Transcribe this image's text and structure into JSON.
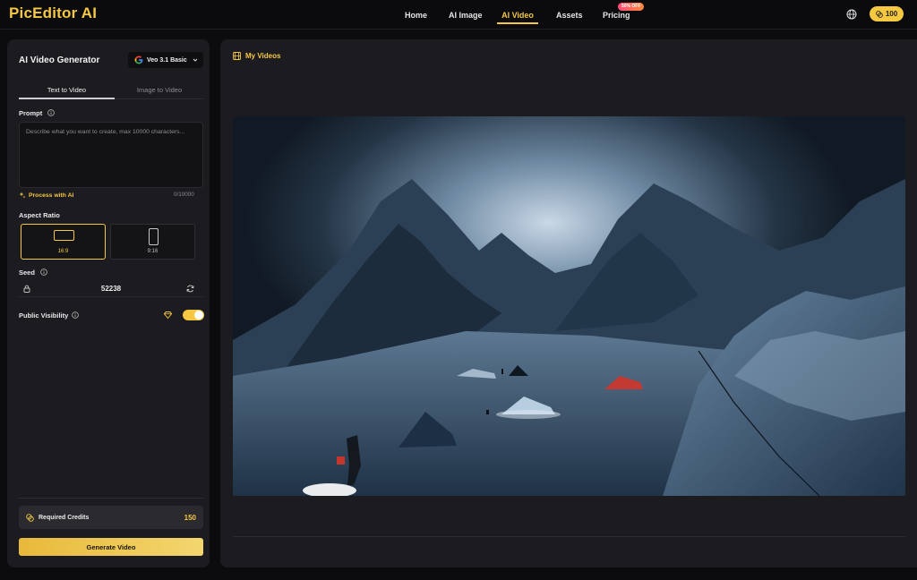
{
  "app": {
    "logo": "PicEditor AI"
  },
  "nav": {
    "items": [
      {
        "label": "Home"
      },
      {
        "label": "AI Image"
      },
      {
        "label": "AI Video",
        "active": true
      },
      {
        "label": "Assets"
      },
      {
        "label": "Pricing",
        "badge": "50% OFF"
      }
    ],
    "credits": "100",
    "globe_icon": "globe-icon"
  },
  "panel": {
    "title": "AI Video Generator",
    "model": "Veo 3.1 Basic",
    "tabs": [
      {
        "label": "Text to Video",
        "active": true
      },
      {
        "label": "Image to Video"
      }
    ],
    "prompt": {
      "label": "Prompt",
      "placeholder": "Describe what you want to create, max 10000 characters...",
      "count": "0/10000",
      "process_label": "Process with AI"
    },
    "aspect": {
      "label": "Aspect Ratio",
      "options": [
        {
          "label": "16:9",
          "selected": true
        },
        {
          "label": "9:16"
        }
      ]
    },
    "seed": {
      "label": "Seed",
      "value": "52238"
    },
    "visibility": {
      "label": "Public Visibility",
      "enabled": true
    },
    "required": {
      "label": "Required Credits",
      "value": "150"
    },
    "generate_label": "Generate Video"
  },
  "main": {
    "title": "My Videos"
  },
  "colors": {
    "accent": "#f5c842",
    "panel": "#1c1c20",
    "background": "#0c0c0e"
  }
}
